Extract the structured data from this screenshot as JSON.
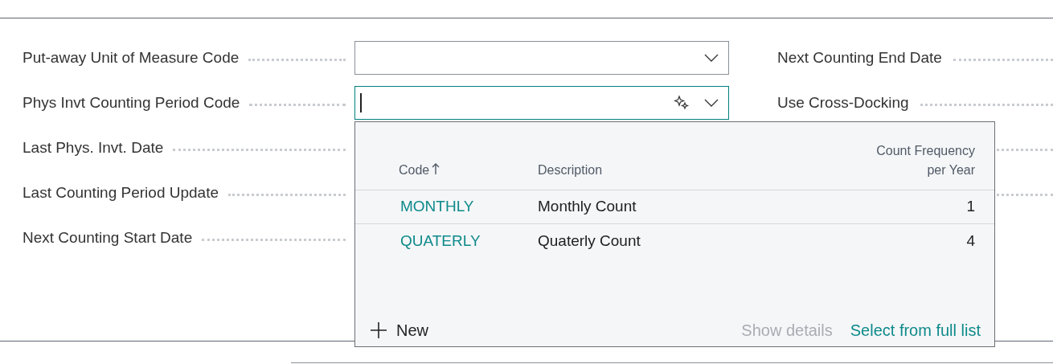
{
  "left_fields": [
    {
      "label": "Put-away Unit of Measure Code",
      "kind": "dropdown",
      "focused": false
    },
    {
      "label": "Phys Invt Counting Period Code",
      "kind": "lookup",
      "focused": true
    },
    {
      "label": "Last Phys. Invt. Date",
      "kind": "hidden"
    },
    {
      "label": "Last Counting Period Update",
      "kind": "hidden"
    },
    {
      "label": "Next Counting Start Date",
      "kind": "hidden"
    }
  ],
  "right_fields": [
    {
      "label": "Next Counting End Date"
    },
    {
      "label": "Use Cross-Docking"
    }
  ],
  "lookup": {
    "columns": [
      {
        "label": "Code",
        "sorted": true
      },
      {
        "label": "Description",
        "sorted": false
      },
      {
        "label": "Count Frequency per Year",
        "sorted": false
      }
    ],
    "rows": [
      {
        "code": "MONTHLY",
        "description": "Monthly Count",
        "frequency": "1"
      },
      {
        "code": "QUATERLY",
        "description": "Quaterly Count",
        "frequency": "4"
      }
    ],
    "new_label": "New",
    "show_details": {
      "label": "Show details",
      "disabled": true
    },
    "select_full": "Select from full list"
  }
}
